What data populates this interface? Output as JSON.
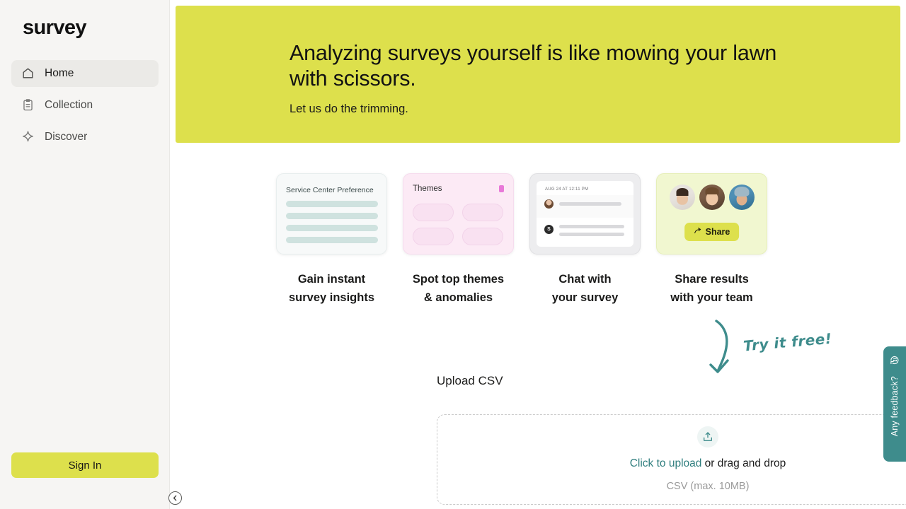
{
  "sidebar": {
    "brand": "survey",
    "items": [
      {
        "label": "Home",
        "icon": "home-icon",
        "active": true
      },
      {
        "label": "Collection",
        "icon": "clipboard-icon",
        "active": false
      },
      {
        "label": "Discover",
        "icon": "sparkle-icon",
        "active": false
      }
    ],
    "sign_in_label": "Sign In",
    "collapse_icon": "chevron-left-circle-icon"
  },
  "hero": {
    "headline": "Analyzing surveys yourself is like mowing your lawn with scissors.",
    "subhead": "Let us do the trimming.",
    "background_color": "#DDE04C"
  },
  "features": [
    {
      "caption": "Gain instant\nsurvey insights",
      "card_title": "Service Center Preference",
      "accent_color": "#CFE2DF"
    },
    {
      "caption": "Spot top themes\n& anomalies",
      "card_title": "Themes",
      "accent_color": "#E879D8"
    },
    {
      "caption": "Chat with\nyour survey",
      "card_timestamp": "AUG 24 AT 12:11 PM",
      "card_badge": "S",
      "accent_color": "#2b2b2b"
    },
    {
      "caption": "Share results\nwith your team",
      "share_label": "Share",
      "share_icon": "share-arrow-icon",
      "accent_color": "#DDE04C"
    }
  ],
  "annotation": {
    "text": "Try it free!",
    "color": "#3E8C8C",
    "arrow_icon": "curved-down-arrow-icon"
  },
  "upload": {
    "section_label": "Upload CSV",
    "icon": "upload-tray-icon",
    "link_text": "Click to upload",
    "rest_text": " or drag and drop",
    "hint": "CSV (max. 10MB)",
    "link_color": "#2F7E7E"
  },
  "feedback": {
    "label": "Any feedback?",
    "icon": "chat-bubble-smile-icon",
    "background_color": "#3E8C8C"
  }
}
